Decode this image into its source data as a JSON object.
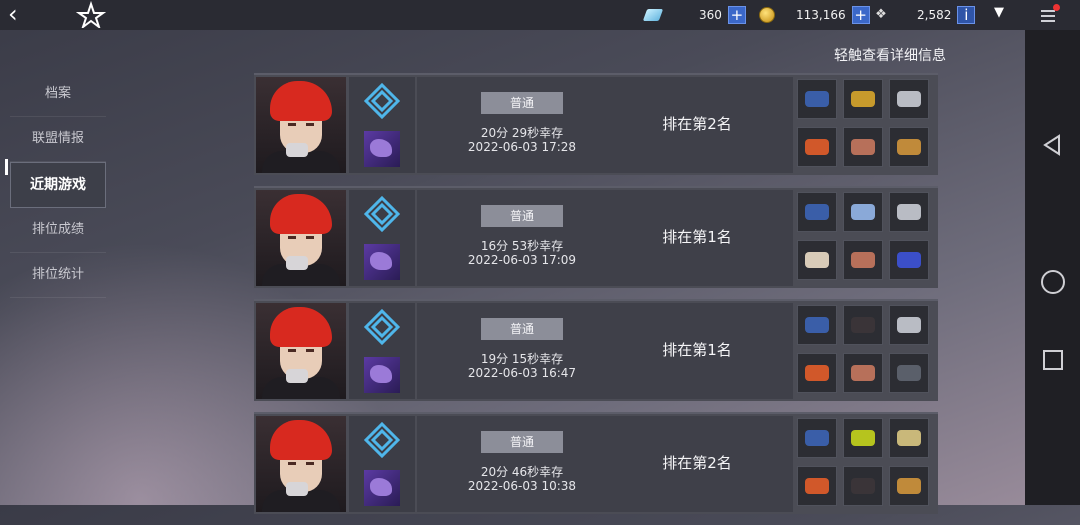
{
  "topbar": {
    "gem_count": "360",
    "coin_count": "113,166",
    "crest_count": "2,582",
    "plus": "+",
    "info": "i",
    "dropdown": "▼",
    "back": "‹"
  },
  "hint": "轻触查看详细信息",
  "sidebar": {
    "items": [
      "档案",
      "联盟情报",
      "近期游戏",
      "排位成绩",
      "排位统计"
    ],
    "active_index": 2
  },
  "matches": [
    {
      "mode": "普通",
      "survival": "20分 29秒幸存",
      "time": "2022-06-03 17:28",
      "rank": "排在第2名",
      "items": [
        "#3a5ea8",
        "#c79a2c",
        "#b9bcc4",
        "#d1582a",
        "#b7705a",
        "#c08a3a"
      ]
    },
    {
      "mode": "普通",
      "survival": "16分 53秒幸存",
      "time": "2022-06-03 17:09",
      "rank": "排在第1名",
      "items": [
        "#3a5ea8",
        "#8aa9d8",
        "#b9bcc4",
        "#d8cbb8",
        "#b7705a",
        "#3b4fc9"
      ]
    },
    {
      "mode": "普通",
      "survival": "19分 15秒幸存",
      "time": "2022-06-03 16:47",
      "rank": "排在第1名",
      "items": [
        "#3a5ea8",
        "#3a3438",
        "#b9bcc4",
        "#d1582a",
        "#b7705a",
        "#5a5f6a"
      ]
    },
    {
      "mode": "普通",
      "survival": "20分 46秒幸存",
      "time": "2022-06-03 10:38",
      "rank": "排在第2名",
      "items": [
        "#3a5ea8",
        "#b6c41e",
        "#c9b87a",
        "#d1582a",
        "#3a3438",
        "#c08a3a"
      ]
    }
  ],
  "colors": {
    "accent": "#3b68c9",
    "hair": "#d8291f",
    "emblem": "#4fb6ea"
  }
}
